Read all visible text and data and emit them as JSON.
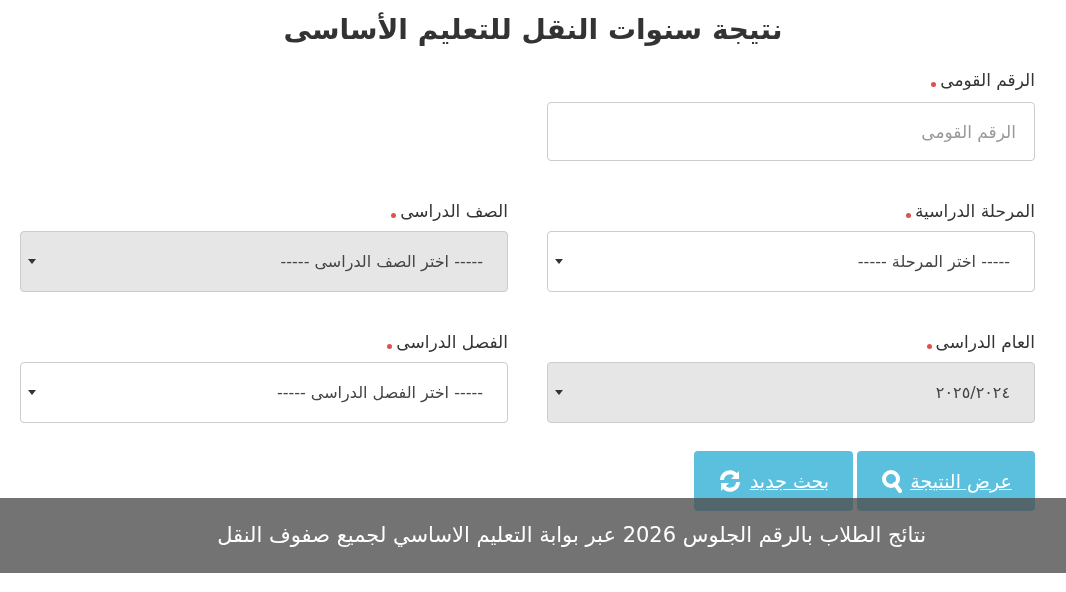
{
  "title": "نتيجة سنوات النقل للتعليم الأساسى",
  "fields": [
    {
      "kind": "input",
      "label": "الرقم القومى",
      "required": true,
      "placeholder": "الرقم القومى",
      "disabled": false
    },
    {
      "kind": "empty"
    },
    {
      "kind": "select",
      "label": "المرحلة الدراسية",
      "required": true,
      "value": "----- اختر المرحلة -----",
      "disabled": false
    },
    {
      "kind": "select",
      "label": "الصف الدراسى",
      "required": true,
      "value": "----- اختر الصف الدراسى -----",
      "disabled": true
    },
    {
      "kind": "select",
      "label": "العام الدراسى",
      "required": true,
      "value": "٢٠٢٥/٢٠٢٤",
      "disabled": true
    },
    {
      "kind": "select",
      "label": "الفصل الدراسى",
      "required": true,
      "value": "----- اختر الفصل الدراسى -----",
      "disabled": false
    }
  ],
  "buttons": [
    {
      "kind": "search",
      "label": "عرض النتيجة"
    },
    {
      "kind": "refresh",
      "label": "بحث جديد"
    }
  ],
  "caption": "نتائج الطلاب بالرقم الجلوس 2026 عبر بوابة التعليم الاساسي لجميع صفوف النقل"
}
